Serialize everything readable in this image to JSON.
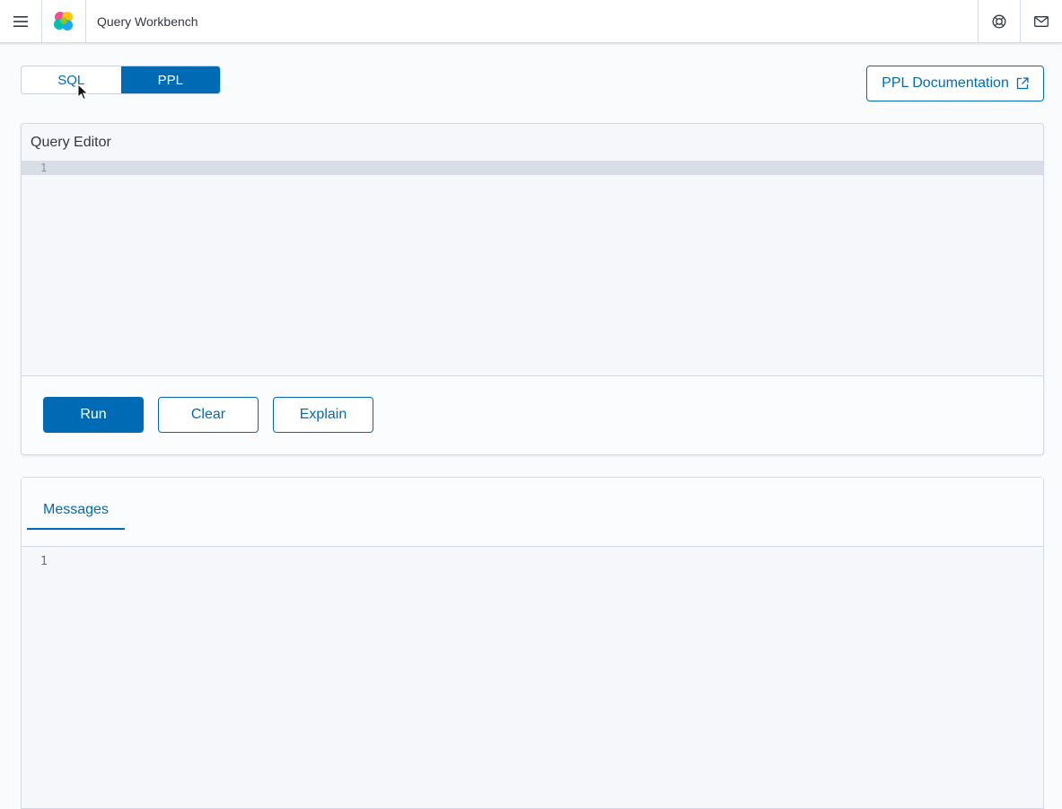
{
  "header": {
    "title": "Query Workbench",
    "menu_icon": "hamburger-menu-icon",
    "logo_icon": "opensearch-logo-icon",
    "help_icon": "help-lifebuoy-icon",
    "mail_icon": "mail-icon"
  },
  "language_toggle": {
    "options": [
      "SQL",
      "PPL"
    ],
    "selected": "PPL"
  },
  "documentation_button": {
    "label": "PPL Documentation",
    "icon": "external-link-icon"
  },
  "query_editor": {
    "title": "Query Editor",
    "line_number": "1",
    "content": ""
  },
  "actions": {
    "run_label": "Run",
    "clear_label": "Clear",
    "explain_label": "Explain"
  },
  "output": {
    "tabs": [
      {
        "label": "Messages",
        "active": true
      }
    ],
    "line_number": "1"
  },
  "colors": {
    "accent": "#006bb4",
    "panel_bg": "#f5f7fa",
    "active_line": "#d8dde6"
  }
}
